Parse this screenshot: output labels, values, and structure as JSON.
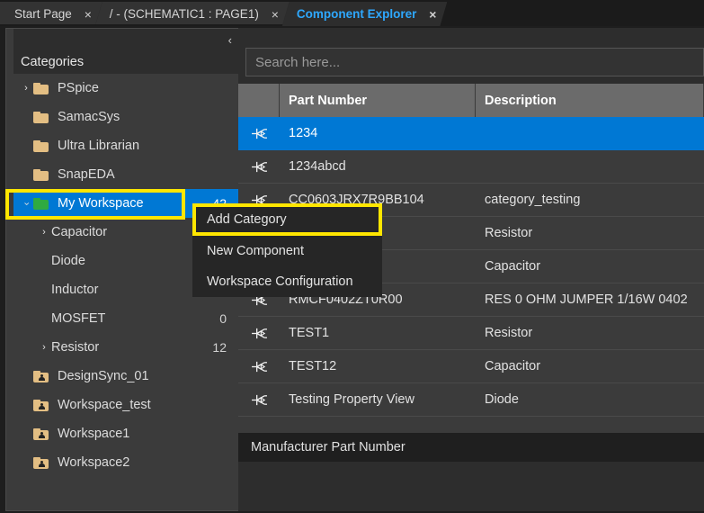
{
  "window": {
    "tabs": [
      {
        "label": "Start Page",
        "close": "×",
        "active": false
      },
      {
        "label": "/ - (SCHEMATIC1 : PAGE1)",
        "close": "×",
        "active": false
      },
      {
        "label": "Component Explorer",
        "close": "×",
        "active": true
      }
    ]
  },
  "sidebar": {
    "collapse_icon": "‹",
    "title": "Categories",
    "items": [
      {
        "label": "PSpice",
        "arrow": "›",
        "expanded": false,
        "folder": "folder-icon",
        "indent": 1,
        "count": ""
      },
      {
        "label": "SamacSys",
        "arrow": "",
        "expanded": false,
        "folder": "folder-icon",
        "indent": 1,
        "count": ""
      },
      {
        "label": "Ultra Librarian",
        "arrow": "",
        "expanded": false,
        "folder": "folder-icon",
        "indent": 1,
        "count": ""
      },
      {
        "label": "SnapEDA",
        "arrow": "",
        "expanded": false,
        "folder": "folder-icon",
        "indent": 1,
        "count": ""
      },
      {
        "label": "My Workspace",
        "arrow": "›",
        "expanded": true,
        "folder": "folder-open-icon",
        "indent": 1,
        "count": "42",
        "selected": true
      },
      {
        "label": "Capacitor",
        "arrow": "›",
        "expanded": false,
        "folder": "",
        "indent": 2,
        "count": ""
      },
      {
        "label": "Diode",
        "arrow": "",
        "expanded": false,
        "folder": "",
        "indent": 2,
        "count": ""
      },
      {
        "label": "Inductor",
        "arrow": "",
        "expanded": false,
        "folder": "",
        "indent": 2,
        "count": ""
      },
      {
        "label": "MOSFET",
        "arrow": "",
        "expanded": false,
        "folder": "",
        "indent": 2,
        "count": "0"
      },
      {
        "label": "Resistor",
        "arrow": "›",
        "expanded": false,
        "folder": "",
        "indent": 2,
        "count": "12"
      },
      {
        "label": "DesignSync_01",
        "arrow": "",
        "expanded": false,
        "folder": "folder-user-icon",
        "indent": 1,
        "count": ""
      },
      {
        "label": "Workspace_test",
        "arrow": "",
        "expanded": false,
        "folder": "folder-user-icon",
        "indent": 1,
        "count": ""
      },
      {
        "label": "Workspace1",
        "arrow": "",
        "expanded": false,
        "folder": "folder-user-icon",
        "indent": 1,
        "count": ""
      },
      {
        "label": "Workspace2",
        "arrow": "",
        "expanded": false,
        "folder": "folder-user-icon",
        "indent": 1,
        "count": ""
      }
    ]
  },
  "search": {
    "value": "",
    "placeholder": "Search here..."
  },
  "grid": {
    "columns": [
      "",
      "Part Number",
      "Description"
    ],
    "rows": [
      {
        "icon": "component-icon",
        "part": "1234",
        "desc": "",
        "selected": true
      },
      {
        "icon": "component-icon",
        "part": "1234abcd",
        "desc": "",
        "selected": false
      },
      {
        "icon": "component-icon",
        "part": "CC0603JRX7R9BB104",
        "desc": "category_testing",
        "selected": false
      },
      {
        "icon": "component-icon",
        "part": "",
        "desc": "Resistor",
        "selected": false
      },
      {
        "icon": "component-icon",
        "part": "",
        "desc": "Capacitor",
        "selected": false
      },
      {
        "icon": "component-icon",
        "part": "RMCF0402ZT0R00",
        "desc": "RES 0 OHM JUMPER 1/16W 0402",
        "selected": false
      },
      {
        "icon": "component-icon",
        "part": "TEST1",
        "desc": "Resistor",
        "selected": false
      },
      {
        "icon": "component-icon",
        "part": "TEST12",
        "desc": "Capacitor",
        "selected": false
      },
      {
        "icon": "component-icon",
        "part": "Testing Property View",
        "desc": "Diode",
        "selected": false
      }
    ]
  },
  "status": {
    "mpn_label": "Manufacturer Part Number"
  },
  "context_menu": {
    "items": [
      {
        "label": "Add Category"
      },
      {
        "label": "New Component"
      },
      {
        "label": "Workspace Configuration"
      }
    ]
  },
  "colors": {
    "accent": "#0078d4",
    "highlight": "#ffe600",
    "folder": "#e3be83",
    "folder_open": "#2faa41",
    "active_tab_text": "#2ea8ff"
  }
}
